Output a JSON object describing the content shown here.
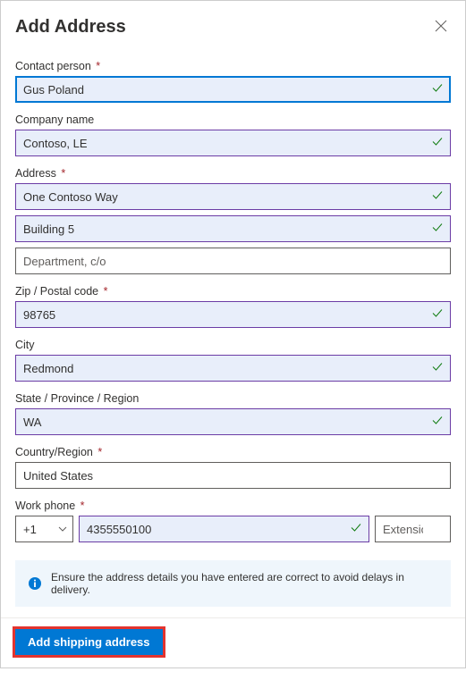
{
  "dialog": {
    "title": "Add Address"
  },
  "fields": {
    "contactPerson": {
      "label": "Contact person",
      "value": "Gus Poland",
      "required": true
    },
    "companyName": {
      "label": "Company name",
      "value": "Contoso, LE",
      "required": false
    },
    "address": {
      "label": "Address",
      "line1": "One Contoso Way",
      "line2": "Building 5",
      "line3Placeholder": "Department, c/o",
      "required": true
    },
    "zipCode": {
      "label": "Zip / Postal code",
      "value": "98765",
      "required": true
    },
    "city": {
      "label": "City",
      "value": "Redmond",
      "required": false
    },
    "state": {
      "label": "State / Province / Region",
      "value": "WA",
      "required": false
    },
    "country": {
      "label": "Country/Region",
      "value": "United States",
      "required": true
    },
    "workPhone": {
      "label": "Work phone",
      "countryCode": "+1",
      "value": "4355550100",
      "extPlaceholder": "Extension",
      "required": true
    }
  },
  "banner": {
    "text": "Ensure the address details you have entered are correct to avoid delays in delivery."
  },
  "footer": {
    "submitLabel": "Add shipping address"
  }
}
